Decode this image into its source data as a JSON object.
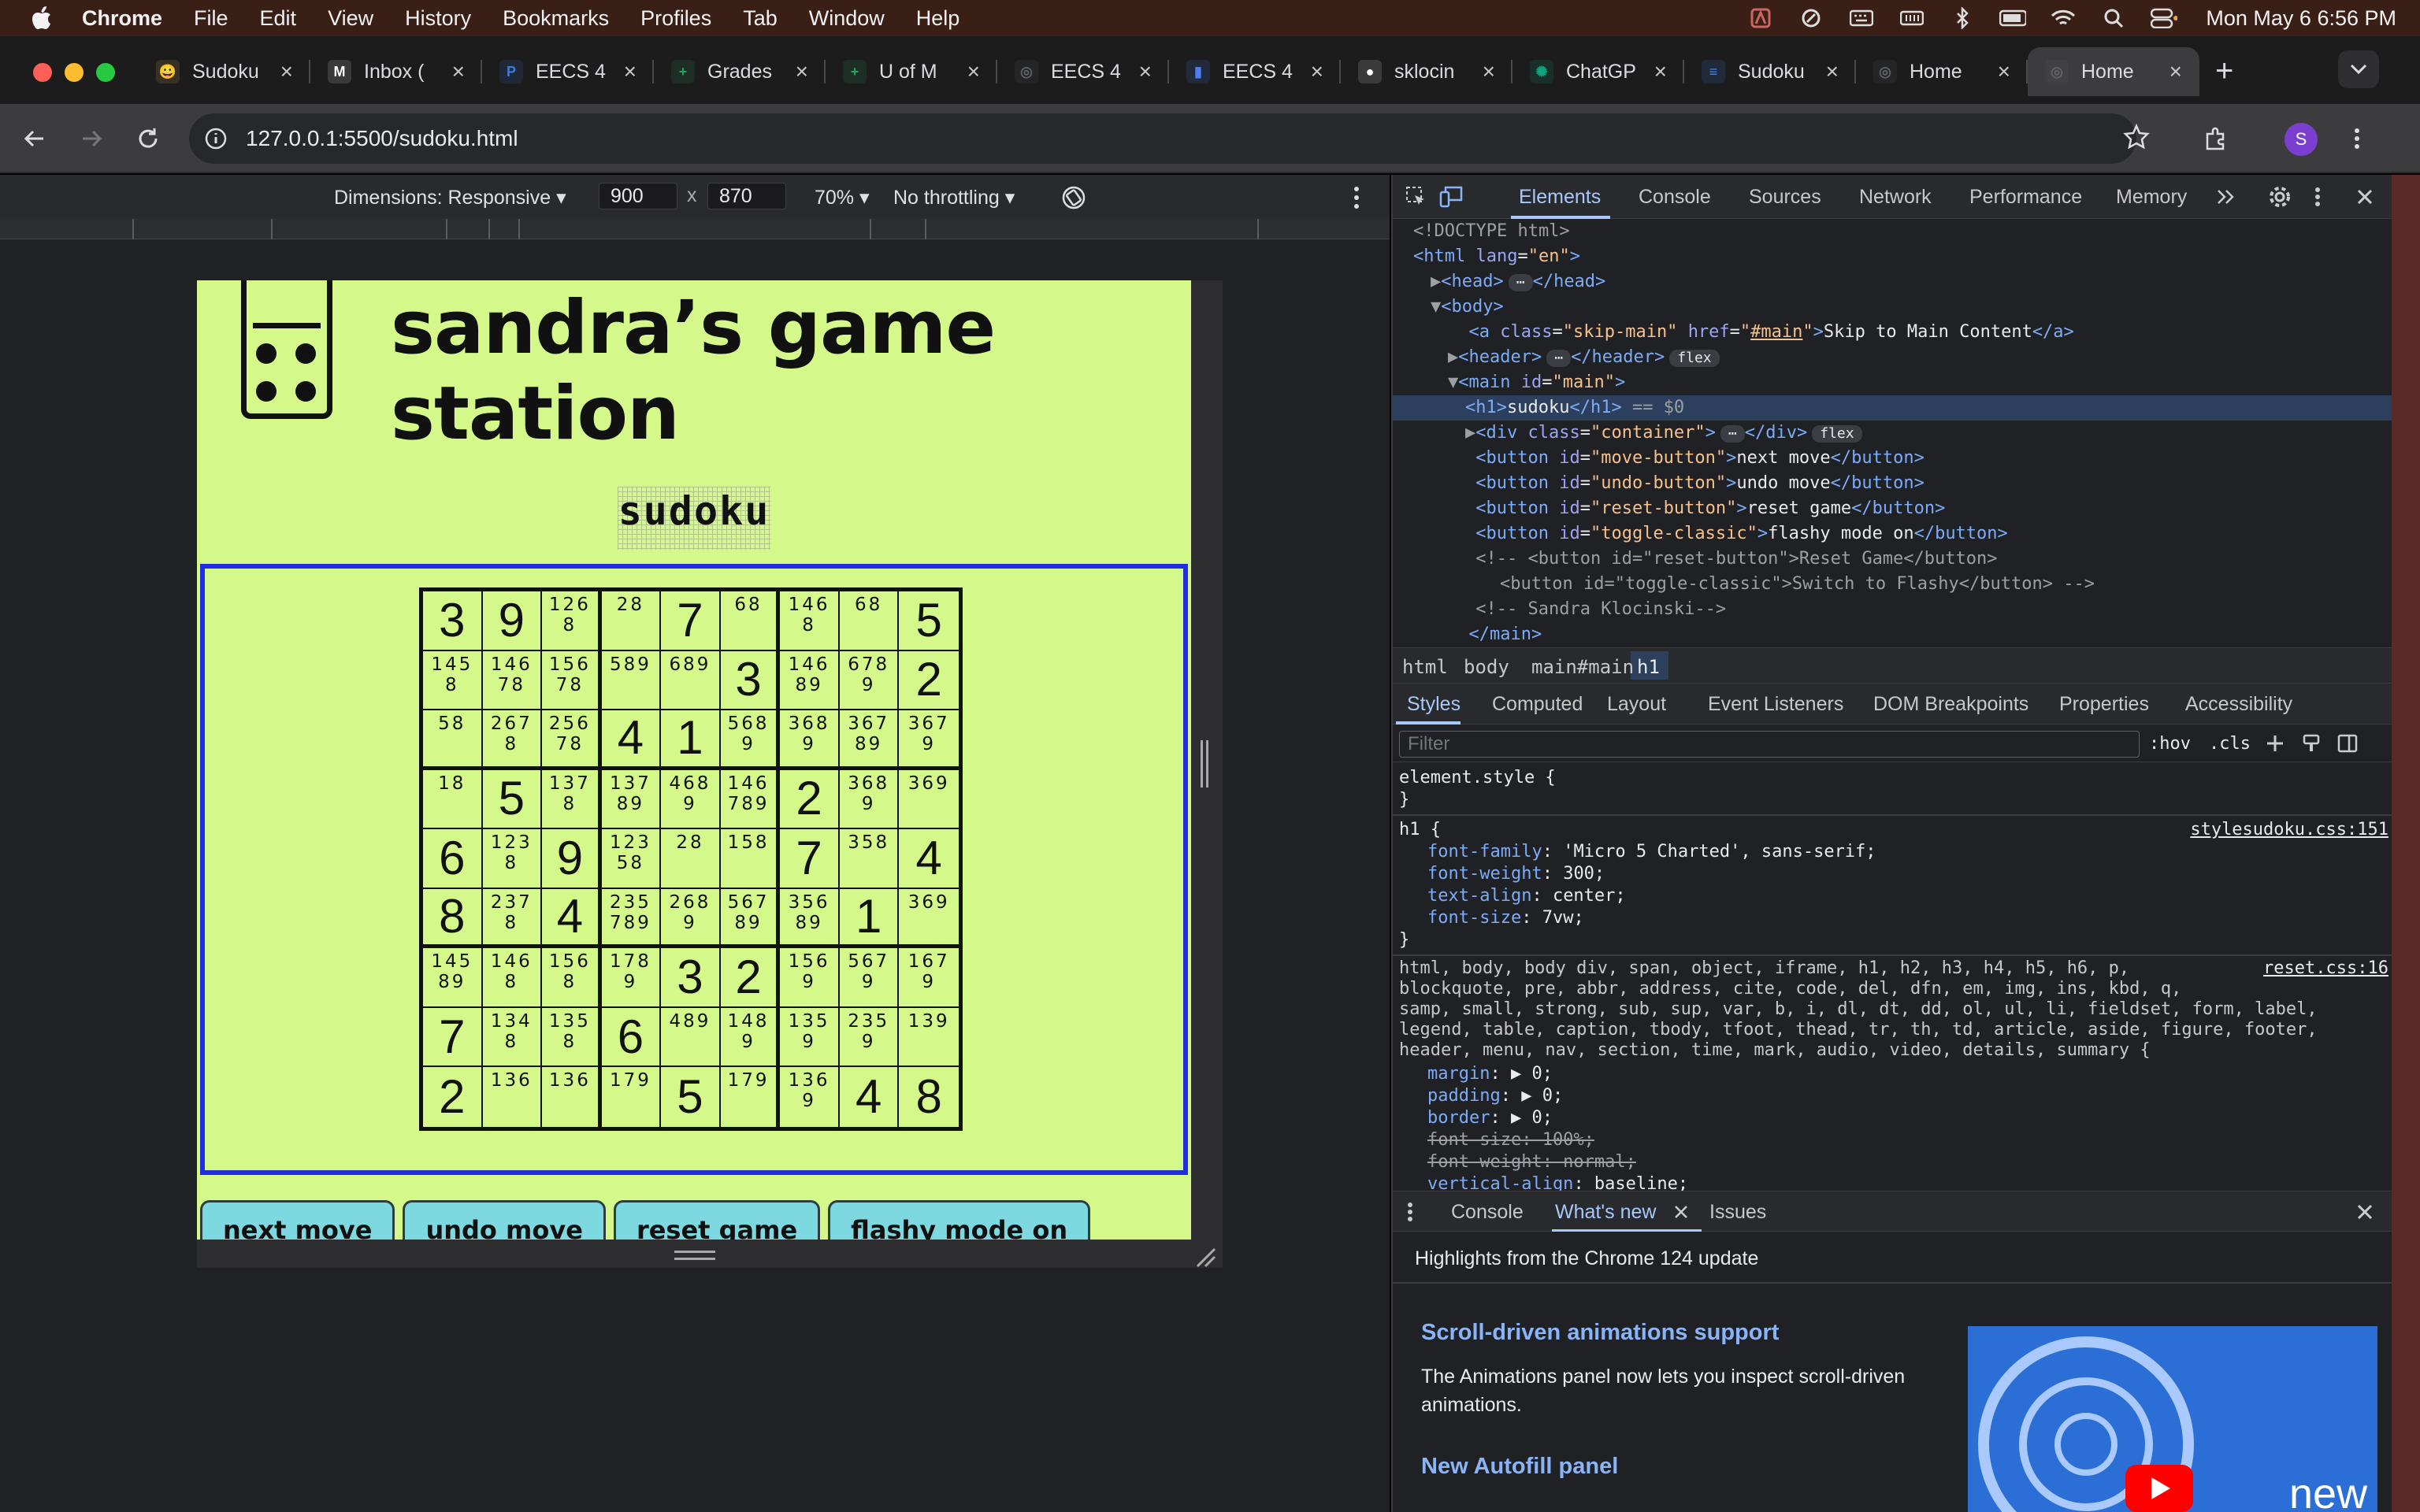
{
  "menubar": {
    "app": "Chrome",
    "items": [
      "File",
      "Edit",
      "View",
      "History",
      "Bookmarks",
      "Profiles",
      "Tab",
      "Window",
      "Help"
    ],
    "clock": "Mon May 6  6:56 PM",
    "status_icons": [
      "adobe-icon",
      "sync-icon",
      "keyboard-icon",
      "memory-icon",
      "bluetooth-icon",
      "battery-icon",
      "wifi-icon",
      "search-icon",
      "control-center-icon"
    ]
  },
  "tabs": [
    {
      "title": "Sudoku",
      "favicon": "game-icon",
      "color": "#f2b84b",
      "glyph": "😀"
    },
    {
      "title": "Inbox (",
      "favicon": "gmail-icon",
      "color": "#ffffff",
      "glyph": "M"
    },
    {
      "title": "EECS 4",
      "favicon": "piazza-icon",
      "color": "#3e7bd9",
      "glyph": "P"
    },
    {
      "title": "Grades",
      "favicon": "sheets-icon",
      "color": "#1ea362",
      "glyph": "+"
    },
    {
      "title": "U of M",
      "favicon": "sheets-icon",
      "color": "#1ea362",
      "glyph": "+"
    },
    {
      "title": "EECS 4",
      "favicon": "globe-icon",
      "color": "#5f6368",
      "glyph": "◎"
    },
    {
      "title": "EECS 4",
      "favicon": "chart-icon",
      "color": "#4d7ef7",
      "glyph": "▮"
    },
    {
      "title": "sklocin",
      "favicon": "github-icon",
      "color": "#ffffff",
      "glyph": "●"
    },
    {
      "title": "ChatGP",
      "favicon": "chatgpt-icon",
      "color": "#10a37f",
      "glyph": "✺"
    },
    {
      "title": "Sudoku",
      "favicon": "docs-icon",
      "color": "#4285f4",
      "glyph": "≡"
    },
    {
      "title": "Home",
      "favicon": "globe-icon",
      "color": "#5f6368",
      "glyph": "◎"
    },
    {
      "title": "Home",
      "favicon": "globe-icon",
      "color": "#5f6368",
      "glyph": "◎",
      "active": true
    }
  ],
  "toolbar": {
    "url": "127.0.0.1:5500/sudoku.html",
    "avatar": "S"
  },
  "device_toolbar": {
    "dimensions_label": "Dimensions: Responsive ▾",
    "width": "900",
    "height": "870",
    "times": "x",
    "zoom": "70% ▾",
    "throttling": "No throttling ▾"
  },
  "page": {
    "site_title": "sandra’s game station",
    "h1": "sudoku",
    "board": [
      [
        "3",
        "9",
        "126\n8",
        "28",
        "7",
        "68",
        "146\n8",
        "68",
        "5"
      ],
      [
        "145\n8",
        "146\n78",
        "156\n78",
        "589",
        "689",
        "3",
        "146\n89",
        "678\n9",
        "2"
      ],
      [
        "58",
        "267\n8",
        "256\n78",
        "4",
        "1",
        "568\n9",
        "368\n9",
        "367\n89",
        "367\n9"
      ],
      [
        "18",
        "5",
        "137\n8",
        "137\n89",
        "468\n9",
        "146\n789",
        "2",
        "368\n9",
        "369"
      ],
      [
        "6",
        "123\n8",
        "9",
        "123\n58",
        "28",
        "158",
        "7",
        "358",
        "4"
      ],
      [
        "8",
        "237\n8",
        "4",
        "235\n789",
        "268\n9",
        "567\n89",
        "356\n89",
        "1",
        "369"
      ],
      [
        "145\n89",
        "146\n8",
        "156\n8",
        "178\n9",
        "3",
        "2",
        "156\n9",
        "567\n9",
        "167\n9"
      ],
      [
        "7",
        "134\n8",
        "135\n8",
        "6",
        "489",
        "148\n9",
        "135\n9",
        "235\n9",
        "139"
      ],
      [
        "2",
        "136",
        "136",
        "179",
        "5",
        "179",
        "136\n9",
        "4",
        "8"
      ]
    ],
    "buttons": [
      "next move",
      "undo move",
      "reset game",
      "flashy mode on"
    ]
  },
  "devtools": {
    "tabs": [
      "Elements",
      "Console",
      "Sources",
      "Network",
      "Performance",
      "Memory"
    ],
    "dom_lines": [
      {
        "indent": 0,
        "html": "<span class='cm'>&lt;!DOCTYPE html&gt;</span>"
      },
      {
        "indent": 0,
        "html": "<span class='tg'>&lt;html</span> <span class='at'>lang</span>=<span class='av'>\"en\"</span><span class='tg'>&gt;</span>"
      },
      {
        "indent": 1,
        "html": "<span class='cm'>▶</span><span class='tg'>&lt;head&gt;</span><span class='pill'>⋯</span><span class='tg'>&lt;/head&gt;</span>"
      },
      {
        "indent": 1,
        "html": "<span class='cm'>▼</span><span class='tg'>&lt;body&gt;</span>"
      },
      {
        "indent": 2,
        "html": "  <span class='tg'>&lt;a</span> <span class='at'>class</span>=<span class='av'>\"skip-main\"</span> <span class='at'>href</span>=<span class='av'>\"<u>#main</u>\"</span><span class='tg'>&gt;</span>Skip to Main Content<span class='tg'>&lt;/a&gt;</span>"
      },
      {
        "indent": 2,
        "html": "<span class='cm'>▶</span><span class='tg'>&lt;header&gt;</span><span class='pill'>⋯</span><span class='tg'>&lt;/header&gt;</span><span class='pill'>flex</span>"
      },
      {
        "indent": 2,
        "html": "<span class='cm'>▼</span><span class='tg'>&lt;main</span> <span class='at'>id</span>=<span class='av'>\"main\"</span><span class='tg'>&gt;</span>"
      },
      {
        "indent": 3,
        "html": "<span class='tg'>&lt;h1&gt;</span>sudoku<span class='tg'>&lt;/h1&gt;</span> <span class='cm'>== $0</span>",
        "selected": true
      },
      {
        "indent": 3,
        "html": "<span class='cm'>▶</span><span class='tg'>&lt;div</span> <span class='at'>class</span>=<span class='av'>\"container\"</span><span class='tg'>&gt;</span><span class='pill'>⋯</span><span class='tg'>&lt;/div&gt;</span><span class='pill'>flex</span>"
      },
      {
        "indent": 3,
        "html": " <span class='tg'>&lt;button</span> <span class='at'>id</span>=<span class='av'>\"move-button\"</span><span class='tg'>&gt;</span>next move<span class='tg'>&lt;/button&gt;</span>"
      },
      {
        "indent": 3,
        "html": " <span class='tg'>&lt;button</span> <span class='at'>id</span>=<span class='av'>\"undo-button\"</span><span class='tg'>&gt;</span>undo move<span class='tg'>&lt;/button&gt;</span>"
      },
      {
        "indent": 3,
        "html": " <span class='tg'>&lt;button</span> <span class='at'>id</span>=<span class='av'>\"reset-button\"</span><span class='tg'>&gt;</span>reset game<span class='tg'>&lt;/button&gt;</span>"
      },
      {
        "indent": 3,
        "html": " <span class='tg'>&lt;button</span> <span class='at'>id</span>=<span class='av'>\"toggle-classic\"</span><span class='tg'>&gt;</span>flashy mode on<span class='tg'>&lt;/button&gt;</span>"
      },
      {
        "indent": 3,
        "html": " <span class='cm'>&lt;!-- &lt;button id=\"reset-button\"&gt;Reset Game&lt;/button&gt;</span>"
      },
      {
        "indent": 5,
        "html": "<span class='cm'>&lt;button id=\"toggle-classic\"&gt;Switch to Flashy&lt;/button&gt; --&gt;</span>"
      },
      {
        "indent": 3,
        "html": " <span class='cm'>&lt;!-- Sandra Klocinski--&gt;</span>"
      },
      {
        "indent": 2,
        "html": "  <span class='tg'>&lt;/main&gt;</span>"
      }
    ],
    "breadcrumbs": [
      "html",
      "body",
      "main#main",
      "h1"
    ],
    "subtabs": [
      "Styles",
      "Computed",
      "Layout",
      "Event Listeners",
      "DOM Breakpoints",
      "Properties",
      "Accessibility"
    ],
    "filter_placeholder": "Filter",
    "filter_opts": [
      ":hov",
      ".cls"
    ],
    "styles": {
      "element_style": "element.style {",
      "close": "}",
      "rule1_selector": "h1 {",
      "rule1_source": "stylesudoku.css:151",
      "rule1_props": [
        "font-family: 'Micro 5 Charted', sans-serif;",
        "font-weight: 300;",
        "text-align: center;",
        "font-size: 7vw;"
      ],
      "rule2_selector_lines": [
        "html, body, body div, span, object, iframe, h1, h2, h3, h4, h5, h6, p,",
        "blockquote, pre, abbr, address, cite, code, del, dfn, em, img, ins, kbd, q,",
        "samp, small, strong, sub, sup, var, b, i, dl, dt, dd, ol, ul, li, fieldset, form, label,",
        "legend, table, caption, tbody, tfoot, thead, tr, th, td, article, aside, figure, footer,",
        "header, menu, nav, section, time, mark, audio, video, details, summary {"
      ],
      "rule2_source": "reset.css:16",
      "rule2_props": [
        {
          "text": "margin: ▶ 0;",
          "struck": false
        },
        {
          "text": "padding: ▶ 0;",
          "struck": false
        },
        {
          "text": "border: ▶ 0;",
          "struck": false
        },
        {
          "text": "font-size: 100%;",
          "struck": true
        },
        {
          "text": "font-weight: normal;",
          "struck": true
        },
        {
          "text": "vertical-align: baseline;",
          "struck": false
        }
      ]
    },
    "drawer": {
      "tabs": [
        "Console",
        "What's new",
        "Issues"
      ],
      "headline": "Highlights from the Chrome 124 update",
      "feature1_title": "Scroll-driven animations support",
      "feature1_body": "The Animations panel now lets you inspect scroll-driven animations.",
      "feature2_title": "New Autofill panel",
      "image_caption": "new"
    }
  }
}
